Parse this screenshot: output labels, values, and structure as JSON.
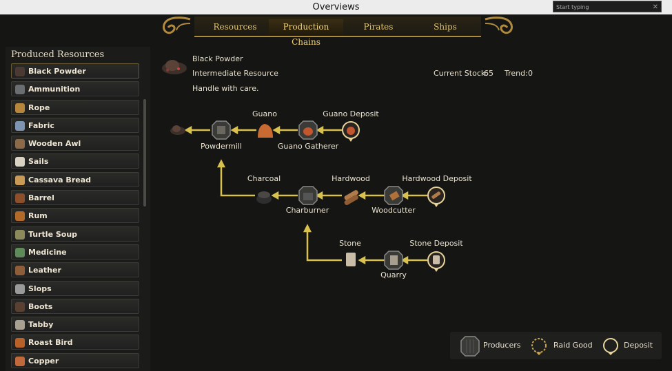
{
  "window": {
    "title": "Overviews",
    "search_placeholder": "Start typing",
    "close_glyph": "✕"
  },
  "tabs": [
    {
      "label": "Resources",
      "active": false
    },
    {
      "label": "Production Chains",
      "active": true
    },
    {
      "label": "Pirates",
      "active": false
    },
    {
      "label": "Ships",
      "active": false
    }
  ],
  "sidebar": {
    "title": "Produced Resources",
    "items": [
      {
        "label": "Black Powder",
        "icon": "black-powder-icon",
        "color": "#4a3a33"
      },
      {
        "label": "Ammunition",
        "icon": "ammunition-icon",
        "color": "#6b6e70"
      },
      {
        "label": "Rope",
        "icon": "rope-icon",
        "color": "#b8863a"
      },
      {
        "label": "Fabric",
        "icon": "fabric-icon",
        "color": "#7d95b0"
      },
      {
        "label": "Wooden Awl",
        "icon": "wooden-awl-icon",
        "color": "#8a6a48"
      },
      {
        "label": "Sails",
        "icon": "sails-icon",
        "color": "#d9d3c4"
      },
      {
        "label": "Cassava Bread",
        "icon": "cassava-bread-icon",
        "color": "#c89a55"
      },
      {
        "label": "Barrel",
        "icon": "barrel-icon",
        "color": "#8c4f2a"
      },
      {
        "label": "Rum",
        "icon": "rum-icon",
        "color": "#b36a28"
      },
      {
        "label": "Turtle Soup",
        "icon": "turtle-soup-icon",
        "color": "#8a8a5a"
      },
      {
        "label": "Medicine",
        "icon": "medicine-icon",
        "color": "#5f8a5a"
      },
      {
        "label": "Leather",
        "icon": "leather-icon",
        "color": "#8e5e3a"
      },
      {
        "label": "Slops",
        "icon": "slops-icon",
        "color": "#9a9a9a"
      },
      {
        "label": "Boots",
        "icon": "boots-icon",
        "color": "#5a4030"
      },
      {
        "label": "Tabby",
        "icon": "tabby-icon",
        "color": "#a8a090"
      },
      {
        "label": "Roast Bird",
        "icon": "roast-bird-icon",
        "color": "#b8622a"
      },
      {
        "label": "Copper",
        "icon": "copper-icon",
        "color": "#c0693a"
      }
    ]
  },
  "detail": {
    "name": "Black Powder",
    "category": "Intermediate Resource",
    "description": "Handle with care.",
    "stock_label": "Current Stock:",
    "stock_value": "65",
    "trend_label": "Trend:",
    "trend_value": "0"
  },
  "chain": {
    "guano": "Guano",
    "guano_deposit": "Guano Deposit",
    "powdermill": "Powdermill",
    "guano_gatherer": "Guano Gatherer",
    "charcoal": "Charcoal",
    "hardwood": "Hardwood",
    "hardwood_deposit": "Hardwood Deposit",
    "charburner": "Charburner",
    "woodcutter": "Woodcutter",
    "stone": "Stone",
    "stone_deposit": "Stone Deposit",
    "quarry": "Quarry"
  },
  "legend": {
    "producers": "Producers",
    "raid_good": "Raid Good",
    "deposit": "Deposit"
  },
  "colors": {
    "accent_gold": "#d9c150",
    "tab_gold": "#e1c474",
    "panel": "#1b1b19"
  }
}
